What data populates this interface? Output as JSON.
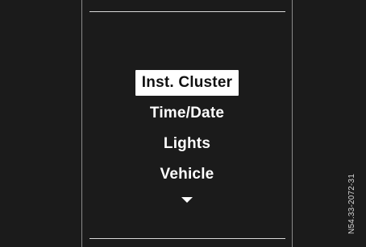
{
  "menu": {
    "items": [
      {
        "label": "Inst. Cluster",
        "selected": true
      },
      {
        "label": "Time/Date",
        "selected": false
      },
      {
        "label": "Lights",
        "selected": false
      },
      {
        "label": "Vehicle",
        "selected": false
      }
    ],
    "scroll_indicator": "down-arrow-icon"
  },
  "figure_code": "N54.33-2072-31",
  "colors": {
    "background": "#1b1b1b",
    "text": "#ffffff",
    "selected_bg": "#ffffff",
    "selected_text": "#111111"
  }
}
